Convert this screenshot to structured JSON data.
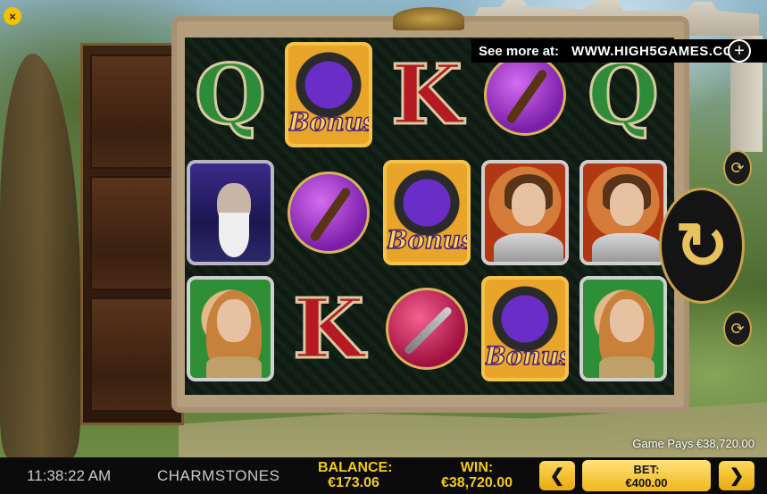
{
  "game": {
    "name": "CHARMSTONES",
    "promo_text": "See more at:",
    "promo_url": "WWW.HIGH5GAMES.COM",
    "game_pays": "Game Pays €38,720.00"
  },
  "status": {
    "time": "11:38:22 AM",
    "balance_label": "BALANCE:",
    "balance_value": "€173.06",
    "win_label": "WIN:",
    "win_value": "€38,720.00",
    "bet_label": "BET:",
    "bet_value": "€400.00"
  },
  "controls": {
    "close_glyph": "×",
    "plus_glyph": "+",
    "spin_glyph": "↻",
    "autoplay_glyph": "⟳",
    "refresh_glyph": "⟳",
    "bet_down_glyph": "❮",
    "bet_up_glyph": "❯"
  },
  "reels": {
    "bonus_text": "Bonus",
    "q_text": "Q",
    "k_text": "K",
    "grid": [
      [
        "Q",
        "Bonus",
        "K",
        "Staff",
        "Q"
      ],
      [
        "Wizard",
        "Staff",
        "Bonus",
        "Knight",
        "Knight"
      ],
      [
        "Princess",
        "K",
        "Sword",
        "Bonus",
        "Princess"
      ]
    ]
  },
  "colors": {
    "accent_gold": "#f3c91a",
    "bar_background": "#0b0b0b"
  }
}
